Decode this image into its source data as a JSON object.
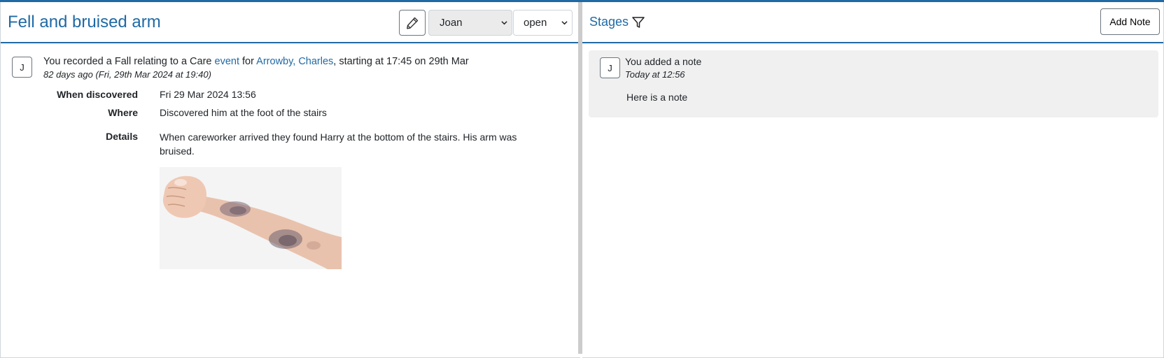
{
  "incident": {
    "title": "Fell and bruised arm",
    "assignee": "Joan",
    "status": "open"
  },
  "event": {
    "avatar_initial": "J",
    "summary_prefix": "You recorded a Fall relating to a Care ",
    "summary_link_event": "event",
    "summary_for": " for ",
    "summary_link_person": "Arrowby, Charles",
    "summary_suffix": ", starting at 17:45 on 29th Mar",
    "time": "82 days ago (Fri, 29th Mar 2024 at 19:40)",
    "details": [
      {
        "label": "When discovered",
        "value": "Fri 29 Mar 2024 13:56"
      },
      {
        "label": "Where",
        "value": "Discovered him at the foot of the stairs"
      },
      {
        "label": "Details",
        "value": "When careworker arrived they found Harry at the bottom of the stairs.  His arm was bruised."
      }
    ]
  },
  "stages": {
    "title": "Stages",
    "add_note_label": "Add Note",
    "notes": [
      {
        "avatar_initial": "J",
        "title": "You added a note",
        "time": "Today at 12:56",
        "body": "Here is a note"
      }
    ]
  },
  "icons": {
    "edit": "pencil-icon",
    "filter": "funnel-icon",
    "select": "chevron-down-icon"
  },
  "colors": {
    "accent": "#1f6aa5",
    "note_background": "#f0f0f0",
    "select_background": "#ebebeb"
  }
}
